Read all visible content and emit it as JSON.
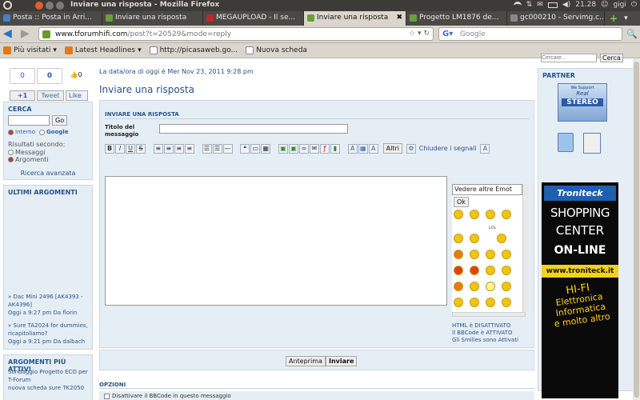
{
  "os": {
    "window_title": "Inviare una risposta - Mozilla Firefox",
    "clock": "21.28",
    "user": "gigi"
  },
  "tabs": [
    {
      "label": "Posta :: Posta in Arri...",
      "active": false,
      "color": "#4a7fc4"
    },
    {
      "label": "Inviare una risposta",
      "active": false,
      "color": "#6aa037"
    },
    {
      "label": "MEGAUPLOAD - Il se...",
      "active": false,
      "color": "#cc2222"
    },
    {
      "label": "Inviare una risposta",
      "active": true,
      "color": "#6aa037"
    },
    {
      "label": "Progetto LM1876 de...",
      "active": false,
      "color": "#6aa037"
    },
    {
      "label": "gc000210 - Servimg.c...",
      "active": false,
      "color": "#888888"
    }
  ],
  "nav": {
    "url_domain": "www.tforumhifi.com",
    "url_path": "/post?t=20529&mode=reply",
    "search_placeholder": "Google"
  },
  "bookmarks": [
    {
      "label": "Più visitati",
      "color": "#e07a1c",
      "dropdown": true
    },
    {
      "label": "Latest Headlines",
      "color": "#e07a1c",
      "dropdown": true
    },
    {
      "label": "http://picasaweb.go...",
      "color": "#cccccc",
      "dropdown": false
    },
    {
      "label": "Nuova scheda",
      "color": "#cccccc",
      "dropdown": false
    }
  ],
  "social": {
    "count_a": "0",
    "count_b": "0",
    "count_c": "0",
    "plus": "+1",
    "tweet": "Tweet",
    "like": "Like"
  },
  "left": {
    "search_head": "CERCA",
    "go": "Go",
    "scope_internal": "Interno",
    "scope_google": "Google",
    "results_label": "Risultati secondo:",
    "res_messages": "Messaggi",
    "res_topics": "Argomenti",
    "advanced": "Ricerca avanzata",
    "latest_head": "ULTIMI ARGOMENTI",
    "latest": [
      {
        "title": "» Dac Mini 2496 [AK4393 - AK4396]",
        "meta": "Oggi a 9:27 pm Da florin"
      },
      {
        "title": "» Sure TA2024 for dummies, ricapitoliamo?",
        "meta": "Oggi a 9:21 pm Da dalbach"
      }
    ],
    "active_head": "ARGOMENTI PIÙ ATTIVI",
    "active": [
      "Sondaggio Progetto ECO per T-Forum",
      "nuova scheda sure TK2050"
    ]
  },
  "main": {
    "date_line": "La data/ora di oggi è Mer Nov 23, 2011 9:28 pm",
    "title": "Inviare una risposta",
    "box_head": "INVIARE UNA RISPOSTA",
    "subject_label": "Titolo del messaggio",
    "subject_value": "",
    "toolbar_others": "Altri",
    "close_tags": "Chiudere i segnali",
    "message_value": "",
    "emoticons_select": "Vedere altre Emot",
    "ok": "Ok",
    "lol": "LOL",
    "html_status": "HTML è DISATTIVATO",
    "bbcode_status": "Il BBCode è ATTIVATO",
    "smilies_status": "Gli Smilies sono Attivati",
    "preview": "Anteprima",
    "submit": "Inviare",
    "options_head": "OPZIONI",
    "opt1": "Disattivare il BBCode in questo messaggio"
  },
  "right": {
    "partner_head": "PARTNER",
    "stereo_top": "We Support",
    "stereo_mid": "Real",
    "stereo_word": "STEREO",
    "ad_brand": "Troniteck",
    "ad_l1": "SHOPPING",
    "ad_l2": "CENTER",
    "ad_l3": "ON-LINE",
    "ad_url": "www.troniteck.it",
    "ad_hifi": "HI-FI",
    "ad_elet": "Elettronica",
    "ad_info": "Informatica",
    "ad_more": "e molto altro",
    "top_search_ph": "Cercare...",
    "top_search_btn": "Cerca"
  }
}
